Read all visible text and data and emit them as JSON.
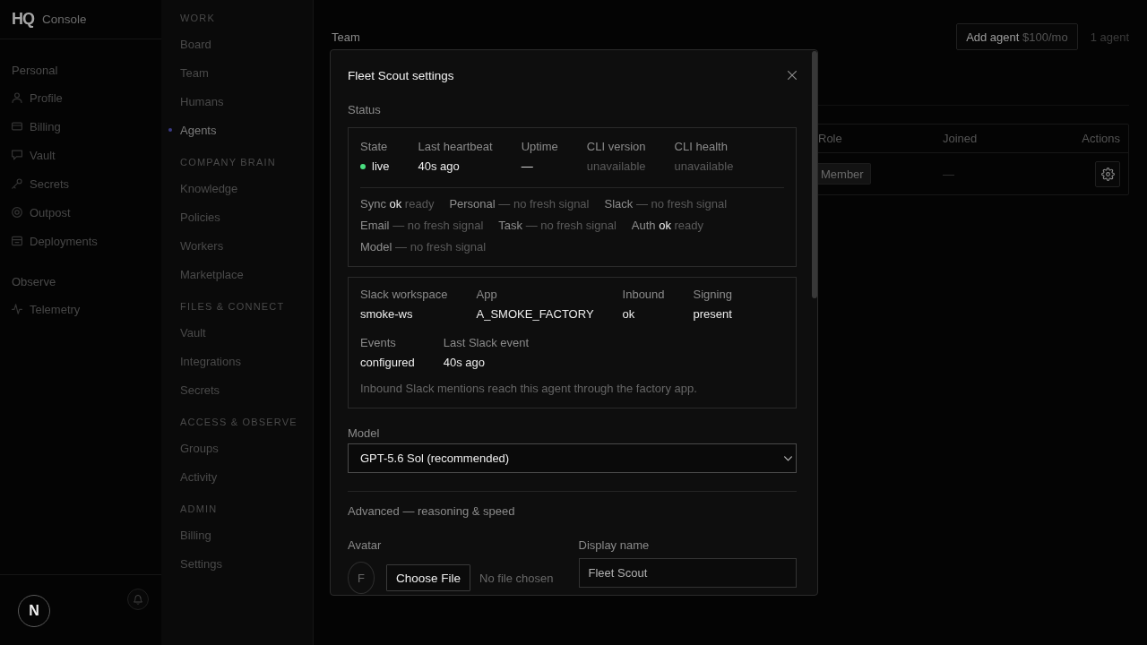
{
  "brand": {
    "logo": "HQ",
    "name": "Console"
  },
  "sidebar": {
    "sections": [
      {
        "title": "Personal",
        "items": [
          {
            "label": "Profile",
            "selected": false
          },
          {
            "label": "Billing",
            "selected": false
          },
          {
            "label": "Vault",
            "selected": false
          },
          {
            "label": "Secrets",
            "selected": false
          },
          {
            "label": "Outpost",
            "selected": false
          },
          {
            "label": "Deployments",
            "selected": false
          }
        ]
      },
      {
        "title": "Observe",
        "items": [
          {
            "label": "Telemetry",
            "selected": false
          }
        ]
      }
    ]
  },
  "dev_badge": "N",
  "nav": {
    "sections": [
      {
        "title": "WORK",
        "items": [
          {
            "label": "Board",
            "selected": false
          },
          {
            "label": "Team",
            "selected": false
          },
          {
            "label": "Humans",
            "selected": false
          },
          {
            "label": "Agents",
            "selected": true
          }
        ]
      },
      {
        "title": "COMPANY BRAIN",
        "items": [
          {
            "label": "Knowledge",
            "selected": false
          },
          {
            "label": "Policies",
            "selected": false
          },
          {
            "label": "Workers",
            "selected": false
          },
          {
            "label": "Marketplace",
            "selected": false
          }
        ]
      },
      {
        "title": "FILES & CONNECT",
        "items": [
          {
            "label": "Vault",
            "selected": false
          },
          {
            "label": "Integrations",
            "selected": false
          },
          {
            "label": "Secrets",
            "selected": false
          }
        ]
      },
      {
        "title": "ACCESS & OBSERVE",
        "items": [
          {
            "label": "Groups",
            "selected": false
          },
          {
            "label": "Activity",
            "selected": false
          }
        ]
      },
      {
        "title": "ADMIN",
        "items": [
          {
            "label": "Billing",
            "selected": false
          },
          {
            "label": "Settings",
            "selected": false
          }
        ]
      }
    ]
  },
  "main": {
    "title": "Team",
    "add_button": {
      "label": "Add agent",
      "price": "$100/mo"
    },
    "count": "1 agent",
    "table": {
      "columns": [
        "Role",
        "Joined",
        "Actions"
      ],
      "rows": [
        [
          "Member",
          "—"
        ]
      ]
    }
  },
  "modal": {
    "title": "Fleet Scout settings",
    "status": {
      "heading": "Status",
      "fields": [
        {
          "label": "State",
          "value": "live",
          "color": "#4ade80",
          "muted": false
        },
        {
          "label": "Last heartbeat",
          "value": "40s ago",
          "muted": false
        },
        {
          "label": "Uptime",
          "value": "—",
          "muted": false
        },
        {
          "label": "CLI version",
          "value": "unavailable",
          "muted": true
        },
        {
          "label": "CLI health",
          "value": "unavailable",
          "muted": true
        }
      ],
      "signals": [
        {
          "name": "Sync",
          "status": "ok",
          "detail": "ready"
        },
        {
          "name": "Personal",
          "detail": "— no fresh signal"
        },
        {
          "name": "Slack",
          "detail": "— no fresh signal"
        },
        {
          "name": "Email",
          "detail": "— no fresh signal"
        },
        {
          "name": "Task",
          "detail": "— no fresh signal"
        },
        {
          "name": "Auth",
          "status": "ok",
          "detail": "ready"
        },
        {
          "name": "Model",
          "detail": "— no fresh signal"
        }
      ]
    },
    "slack": {
      "rows": [
        [
          {
            "label": "Slack workspace",
            "value": "smoke-ws"
          },
          {
            "label": "App",
            "value": "A_SMOKE_FACTORY"
          },
          {
            "label": "Inbound",
            "value": "ok"
          },
          {
            "label": "Signing",
            "value": "present"
          }
        ],
        [
          {
            "label": "Events",
            "value": "configured"
          },
          {
            "label": "Last Slack event",
            "value": "40s ago"
          }
        ]
      ],
      "note": "Inbound Slack mentions reach this agent through the factory app."
    },
    "model": {
      "label": "Model",
      "value": "GPT-5.6 Sol (recommended)"
    },
    "advanced": "Advanced — reasoning & speed",
    "avatar": {
      "label": "Avatar",
      "initial": "F",
      "button": "Choose File",
      "file_status": "No file chosen"
    },
    "display_name": {
      "label": "Display name",
      "value": "Fleet Scout"
    }
  }
}
